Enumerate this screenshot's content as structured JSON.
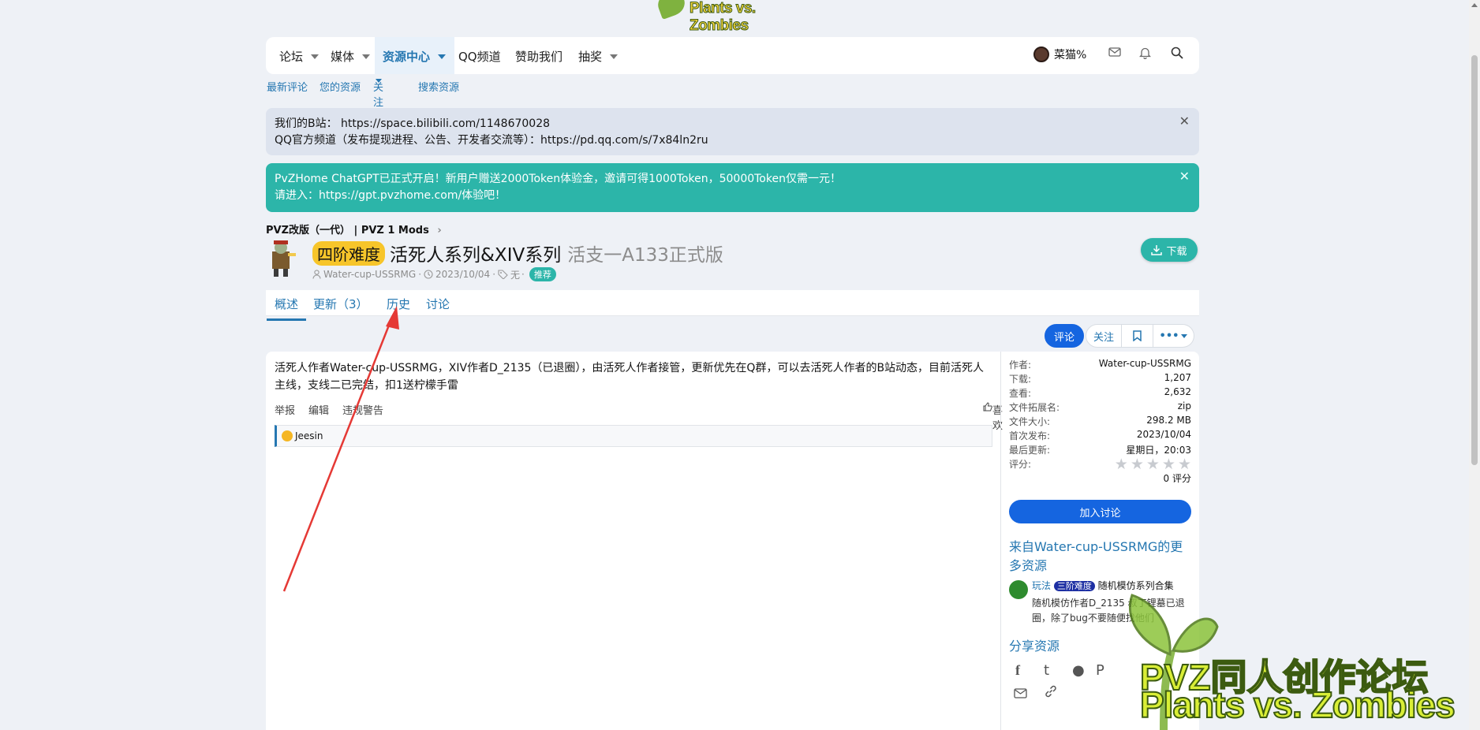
{
  "logo": {
    "text": "Plants vs. Zombies"
  },
  "nav": {
    "items": [
      {
        "label": "论坛",
        "caret": true
      },
      {
        "label": "媒体",
        "caret": true
      },
      {
        "label": "资源中心",
        "caret": true,
        "active": true
      },
      {
        "label": "QQ频道",
        "caret": false
      },
      {
        "label": "赞助我们",
        "caret": false
      },
      {
        "label": "抽奖",
        "caret": true
      }
    ],
    "user": "菜猫%"
  },
  "subnav": {
    "items": [
      "最新评论",
      "您的资源",
      "关注",
      "搜索资源"
    ]
  },
  "notices": [
    {
      "line1": "我们的B站：  https://space.bilibili.com/1148670028",
      "line2": "QQ官方频道（发布提现进程、公告、开发者交流等）：https://pd.qq.com/s/7x84ln2ru",
      "close": "✕"
    },
    {
      "line1": "PvZHome ChatGPT已正式开启！新用户赠送2000Token体验金，邀请可得1000Token，50000Token仅需一元！",
      "line2": "请进入：https://gpt.pvzhome.com/体验吧！",
      "close": "✕"
    }
  ],
  "breadcrumb": "PVZ改版（一代） | PVZ 1 Mods",
  "resource": {
    "difficulty": "四阶难度",
    "title": "活死人系列&XIV系列",
    "version": "活支一A133正式版",
    "author": "Water-cup-USSRMG",
    "date": "2023/10/04",
    "tags": "无",
    "badge": "推荐",
    "download_label": "下载"
  },
  "tabs": [
    "概述",
    "更新（3）",
    "历史",
    "讨论"
  ],
  "actions": {
    "comment": "评论",
    "follow": "关注"
  },
  "description": "活死人作者Water-cup-USSRMG，XIV作者D_2135（已退圈），由活死人作者接管，更新优先在Q群，可以去活死人作者的B站动态，目前活死人主线，支线二已完结，扣1送柠檬手雷",
  "post_actions": {
    "report": "举报",
    "edit": "编辑",
    "warn": "违规警告",
    "like": "喜欢"
  },
  "liker": "Jeesin",
  "info": [
    {
      "k": "作者:",
      "v": "Water-cup-USSRMG"
    },
    {
      "k": "下载:",
      "v": "1,207"
    },
    {
      "k": "查看:",
      "v": "2,632"
    },
    {
      "k": "文件拓展名:",
      "v": "zip"
    },
    {
      "k": "文件大小:",
      "v": "298.2 MB"
    },
    {
      "k": "首次发布:",
      "v": "2023/10/04"
    },
    {
      "k": "最后更新:",
      "v": "星期日，20:03"
    },
    {
      "k": "评分:",
      "v": ""
    }
  ],
  "rating": {
    "score": 0,
    "max": 5,
    "count_text": "0 评分"
  },
  "join_label": "加入讨论",
  "more_heading": "来自Water-cup-USSRMG的更多资源",
  "more_item": {
    "prefix": "玩法",
    "difficulty": "三阶难度",
    "title": "随机模仿系列合集",
    "desc": "随机模仿作者D_2135 叔丁锂墓已退圈，除了bug不要随便找他们"
  },
  "share_heading": "分享资源",
  "watermark": {
    "line1": "PVZ同人创作论坛",
    "line2": "Plants vs. Zombies"
  }
}
